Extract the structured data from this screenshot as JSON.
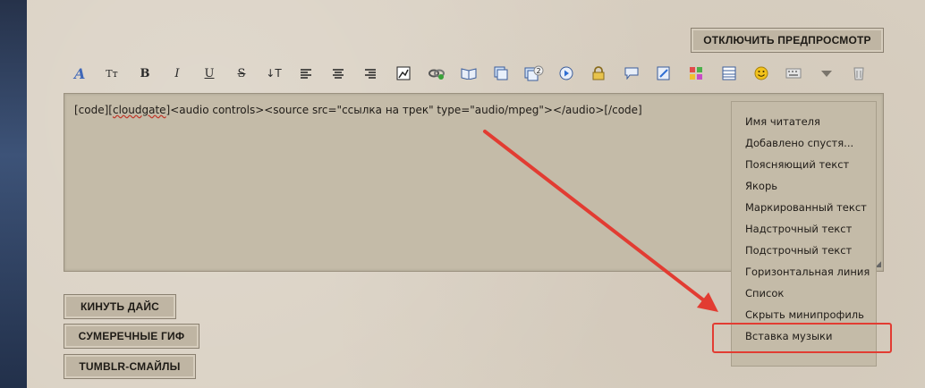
{
  "header": {
    "preview_button": "ОТКЛЮЧИТЬ ПРЕДПРОСМОТР"
  },
  "toolbar": {
    "icons": [
      "font-icon",
      "font-size-icon",
      "bold-icon",
      "italic-icon",
      "underline-icon",
      "strike-icon",
      "align-icon",
      "align-left-icon",
      "align-center-icon",
      "align-right-icon",
      "image-icon",
      "link-icon",
      "book-icon",
      "spoiler-icon",
      "quote-icon",
      "play-icon",
      "lock-icon",
      "comment-icon",
      "edit-icon",
      "color-icon",
      "table-icon",
      "smile-icon",
      "keyboard-icon",
      "dropdown-icon",
      "clear-icon"
    ],
    "badge": "2",
    "labels": {
      "font_size": "Tт",
      "bold": "B",
      "italic": "I",
      "underline": "U",
      "strike": "S",
      "align": "↓T"
    }
  },
  "editor": {
    "text_before": "[code][",
    "text_spell": "cloudgate",
    "text_after": "]<audio controls><source src=\"ссылка на трек\" type=\"audio/mpeg\"></audio>[/code]"
  },
  "menu": {
    "items": [
      "Имя читателя",
      "Добавлено спустя...",
      "Поясняющий текст",
      "Якорь",
      "Маркированный текст",
      "Надстрочный текст",
      "Подстрочный текст",
      "Горизонтальная линия",
      "Список",
      "Скрыть минипрофиль",
      "Вставка музыки"
    ]
  },
  "side_buttons": {
    "dice": "КИНУТЬ ДАЙС",
    "twilight": "СУМЕРЕЧНЫЕ ГИФ",
    "tumblr": "TUMBLR-СМАЙЛЫ"
  },
  "colors": {
    "highlight": "#e23c32",
    "paper": "#d9d0c2",
    "editor": "#c4bba8"
  }
}
